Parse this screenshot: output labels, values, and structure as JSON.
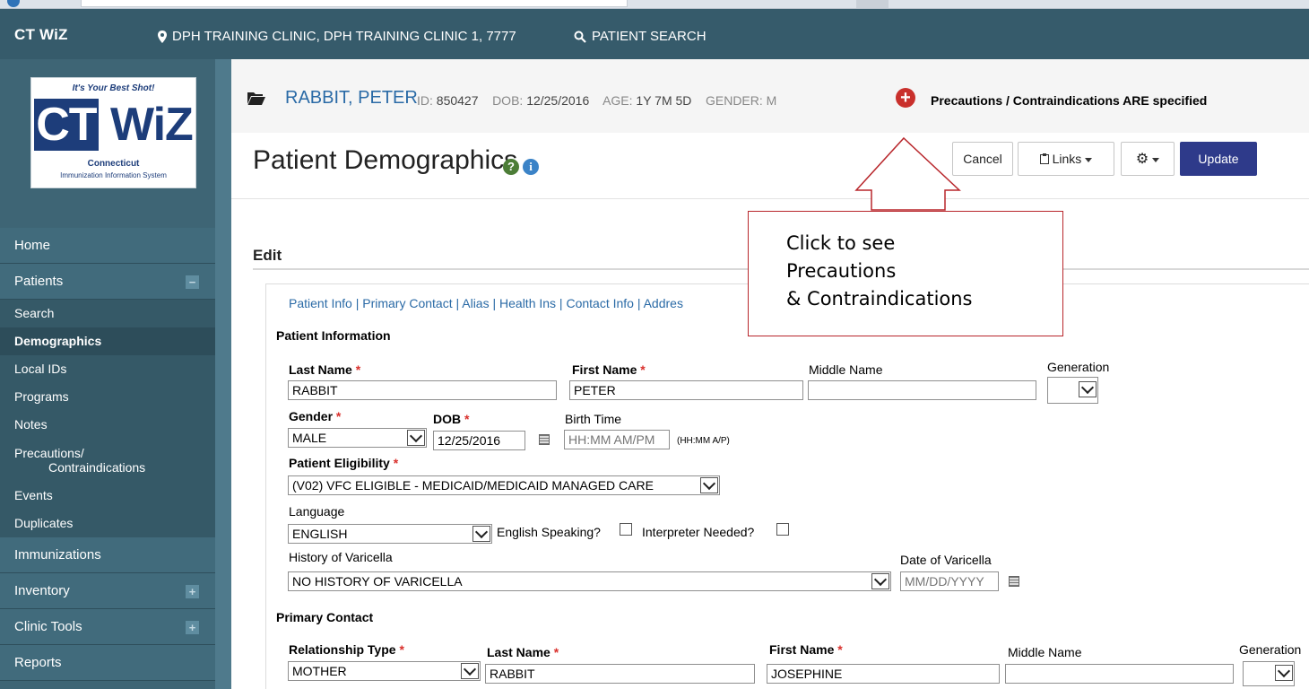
{
  "app": {
    "brand": "CT WiZ",
    "clinic": "DPH TRAINING CLINIC, DPH TRAINING CLINIC 1, 7777",
    "patient_search": "PATIENT SEARCH"
  },
  "logo": {
    "tagline": "It's Your Best Shot!",
    "word": "CT WiZ",
    "sub1": "Connecticut",
    "sub2": "Immunization Information System"
  },
  "sidebar": {
    "home": "Home",
    "patients": "Patients",
    "patients_sub": [
      "Search",
      "Demographics",
      "Local IDs",
      "Programs",
      "Notes",
      "Precautions/",
      "Contraindications",
      "Events",
      "Duplicates"
    ],
    "immunizations": "Immunizations",
    "inventory": "Inventory",
    "clinic_tools": "Clinic Tools",
    "reports": "Reports"
  },
  "patient": {
    "name": "RABBIT, PETER",
    "id_label": "ID:",
    "id": "850427",
    "dob_label": "DOB:",
    "dob": "12/25/2016",
    "age_label": "AGE:",
    "age": "1Y 7M 5D",
    "gender_label": "GENDER:",
    "gender": "M",
    "precautions": "Precautions / Contraindications ARE specified"
  },
  "page": {
    "title": "Patient Demographics",
    "help": "?",
    "info": "i",
    "edit": "Edit"
  },
  "toolbar": {
    "cancel": "Cancel",
    "links": "Links",
    "update": "Update"
  },
  "tabs": "Patient Info  | Primary Contact  | Alias  | Health Ins  | Contact Info  | Addres",
  "patient_info": {
    "section": "Patient Information",
    "last_name_label": "Last Name",
    "last_name": "RABBIT",
    "first_name_label": "First Name",
    "first_name": "PETER",
    "middle_name_label": "Middle Name",
    "middle_name": "",
    "generation_label": "Generation",
    "gender_label": "Gender",
    "gender": "MALE",
    "dob_label": "DOB",
    "dob": "12/25/2016",
    "birth_time_label": "Birth Time",
    "birth_time_placeholder": "HH:MM AM/PM",
    "birth_time_hint": "(HH:MM A/P)",
    "eligibility_label": "Patient Eligibility",
    "eligibility": "(V02) VFC ELIGIBLE - MEDICAID/MEDICAID MANAGED CARE",
    "language_label": "Language",
    "language": "ENGLISH",
    "english_speaking_label": "English Speaking?",
    "interpreter_label": "Interpreter Needed?",
    "varicella_label": "History of Varicella",
    "varicella": "NO HISTORY OF VARICELLA",
    "varicella_date_label": "Date of Varicella",
    "varicella_date_placeholder": "MM/DD/YYYY"
  },
  "primary_contact": {
    "section": "Primary Contact",
    "relationship_label": "Relationship Type",
    "relationship": "MOTHER",
    "last_name_label": "Last Name",
    "last_name": "RABBIT",
    "first_name_label": "First Name",
    "first_name": "JOSEPHINE",
    "middle_name_label": "Middle Name",
    "generation_label": "Generation"
  },
  "required_mark": "*",
  "callout": {
    "line1": "Click to see",
    "line2": "Precautions",
    "line3": "& Contraindications"
  },
  "colors": {
    "topbar": "#365b6b",
    "sidebar": "#3e6575",
    "link": "#2a6aa6",
    "update_button": "#2e3a8a",
    "alert": "#c9302c",
    "callout_border": "#b8262b"
  }
}
